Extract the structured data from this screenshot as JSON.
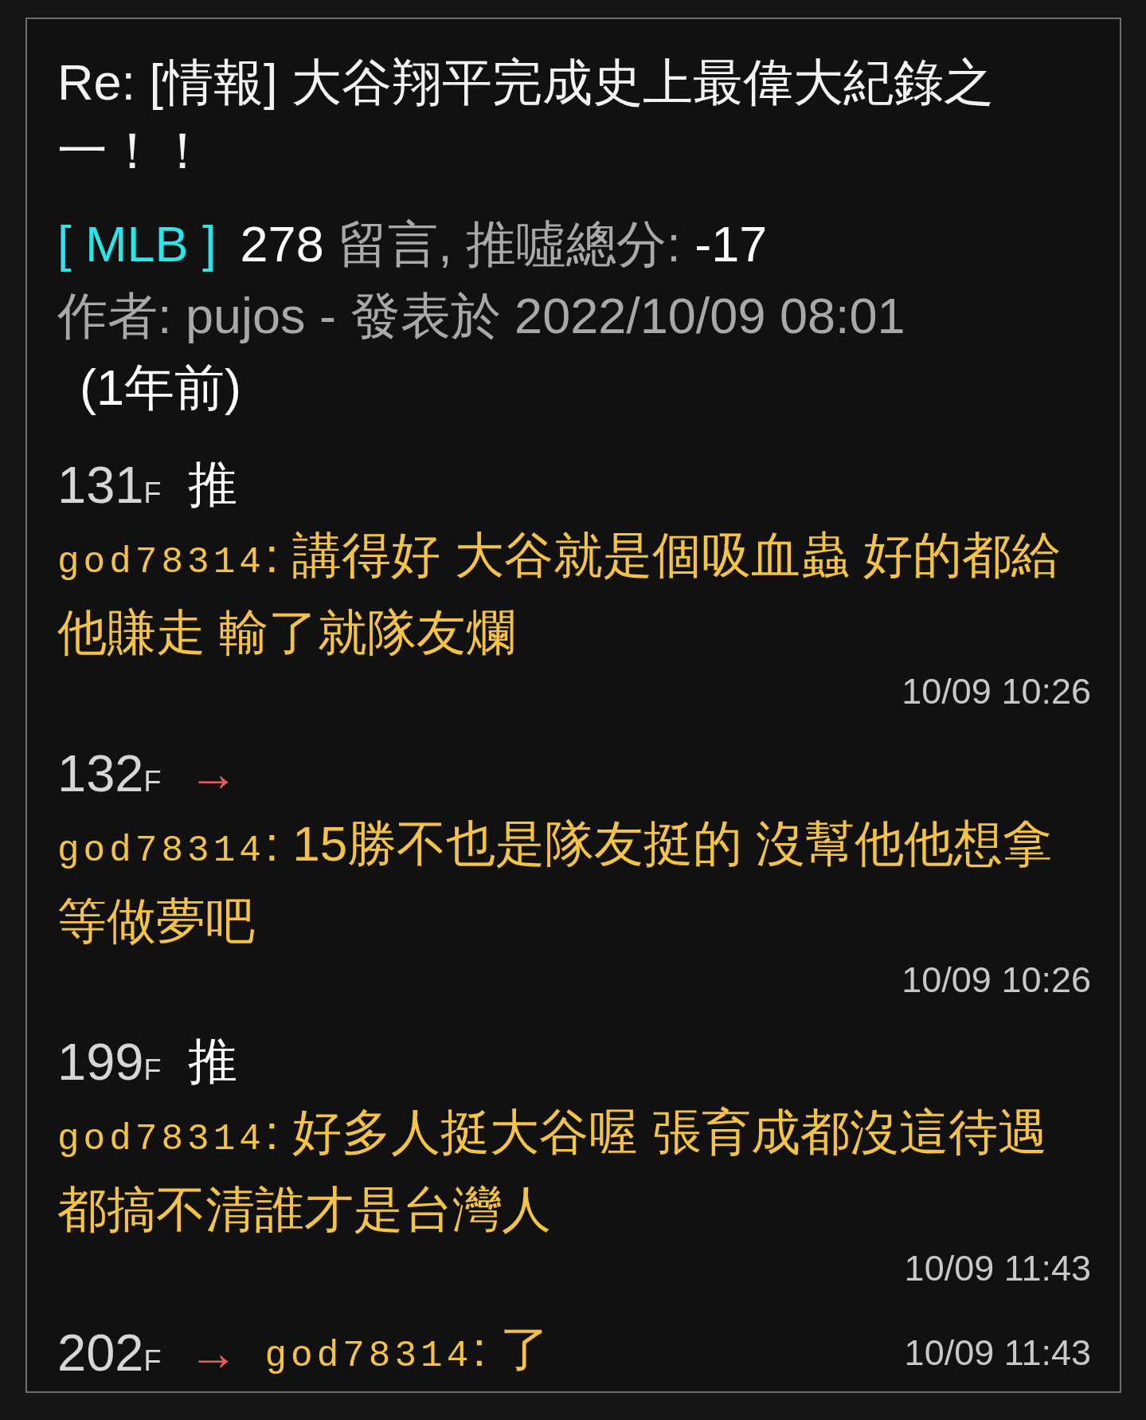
{
  "post": {
    "title": "Re: [情報] 大谷翔平完成史上最偉大紀錄之一！！",
    "board": "[ MLB ]",
    "comment_count": "278",
    "count_label": "留言, 推噓總分:",
    "score": "-17",
    "author_line": "作者: pujos - 發表於 2022/10/09 08:01",
    "age": "(1年前)"
  },
  "comments": [
    {
      "floor": "131",
      "floor_suffix": "F",
      "tag": "推",
      "kind": "push",
      "compact": false,
      "user": "god78314",
      "text": ": 講得好 大谷就是個吸血蟲 好的都給他賺走 輸了就隊友爛",
      "time": "10/09 10:26"
    },
    {
      "floor": "132",
      "floor_suffix": "F",
      "tag": "→",
      "kind": "arrow",
      "compact": false,
      "user": "god78314",
      "text": ": 15勝不也是隊友挺的 沒幫他他想拿等做夢吧",
      "time": "10/09 10:26"
    },
    {
      "floor": "199",
      "floor_suffix": "F",
      "tag": "推",
      "kind": "push",
      "compact": false,
      "user": "god78314",
      "text": ": 好多人挺大谷喔 張育成都沒這待遇都搞不清誰才是台灣人",
      "time": "10/09 11:43"
    },
    {
      "floor": "202",
      "floor_suffix": "F",
      "tag": "→",
      "kind": "arrow",
      "compact": true,
      "user": "god78314",
      "text": ": 了",
      "time": "10/09 11:43"
    }
  ]
}
